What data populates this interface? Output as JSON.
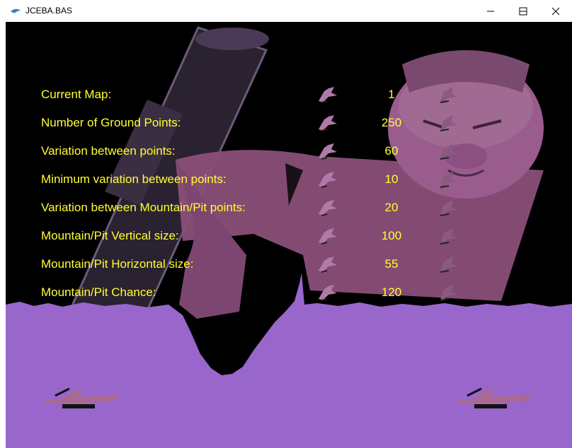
{
  "window": {
    "title": "JCEBA.BAS"
  },
  "settings": {
    "rows": [
      {
        "label": "Current Map:",
        "value": "1"
      },
      {
        "label": "Number of Ground Points:",
        "value": "250"
      },
      {
        "label": "Variation between points:",
        "value": "60"
      },
      {
        "label": "Minimum variation between points:",
        "value": "10"
      },
      {
        "label": "Variation between Mountain/Pit points:",
        "value": "20"
      },
      {
        "label": "Mountain/Pit Vertical size:",
        "value": "100"
      },
      {
        "label": "Mountain/Pit Horizontal size:",
        "value": "55"
      },
      {
        "label": "Mountain/Pit Chance:",
        "value": "120"
      }
    ]
  },
  "colors": {
    "text": "#ffff33",
    "ground": "#9966cc",
    "sky": "#000000",
    "overlay": "#8a4f78"
  },
  "icons": {
    "decrease": "jet-sprite-icon",
    "increase": "jet-sprite-icon",
    "player": "plane-sprite-icon"
  }
}
